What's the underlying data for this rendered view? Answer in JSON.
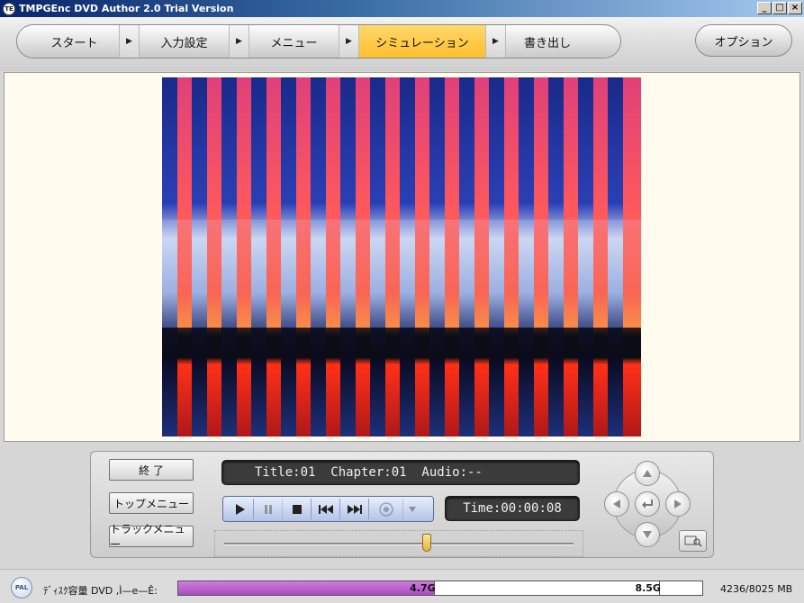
{
  "window": {
    "title": "TMPGEnc DVD Author 2.0 Trial Version",
    "app_icon_text": "TE",
    "minimize_glyph": "_",
    "maximize_glyph": "□",
    "close_glyph": "×"
  },
  "steps": [
    {
      "label": "スタート",
      "active": false
    },
    {
      "label": "入力設定",
      "active": false
    },
    {
      "label": "メニュー",
      "active": false
    },
    {
      "label": "シミュレーション",
      "active": true
    },
    {
      "label": "書き出し",
      "active": false
    }
  ],
  "step_arrow_glyph": "▶",
  "options_label": "オプション",
  "colors": {
    "active_step": "#ffc638",
    "capacity_fill": "#b85ccb",
    "lcd_bg": "#3b3b3b"
  },
  "player": {
    "end_label": "終 了",
    "top_menu_label": "トップメニュー",
    "track_menu_label": "トラックメニュー",
    "info_text": "Title:01  Chapter:01  Audio:--",
    "time_text": "Time:00:00:08",
    "seek_position_fraction": 0.58
  },
  "status": {
    "badge": "PAL",
    "label": "ﾃﾞｨｽｸ容量 DVD ,Ì—e—Ê:",
    "used_label": "4.7G",
    "max_label": "8.5G",
    "used_fraction": 0.49,
    "tick_fraction_1": 0.49,
    "tick_fraction_2": 0.92,
    "size_text": "4236/8025 MB"
  }
}
